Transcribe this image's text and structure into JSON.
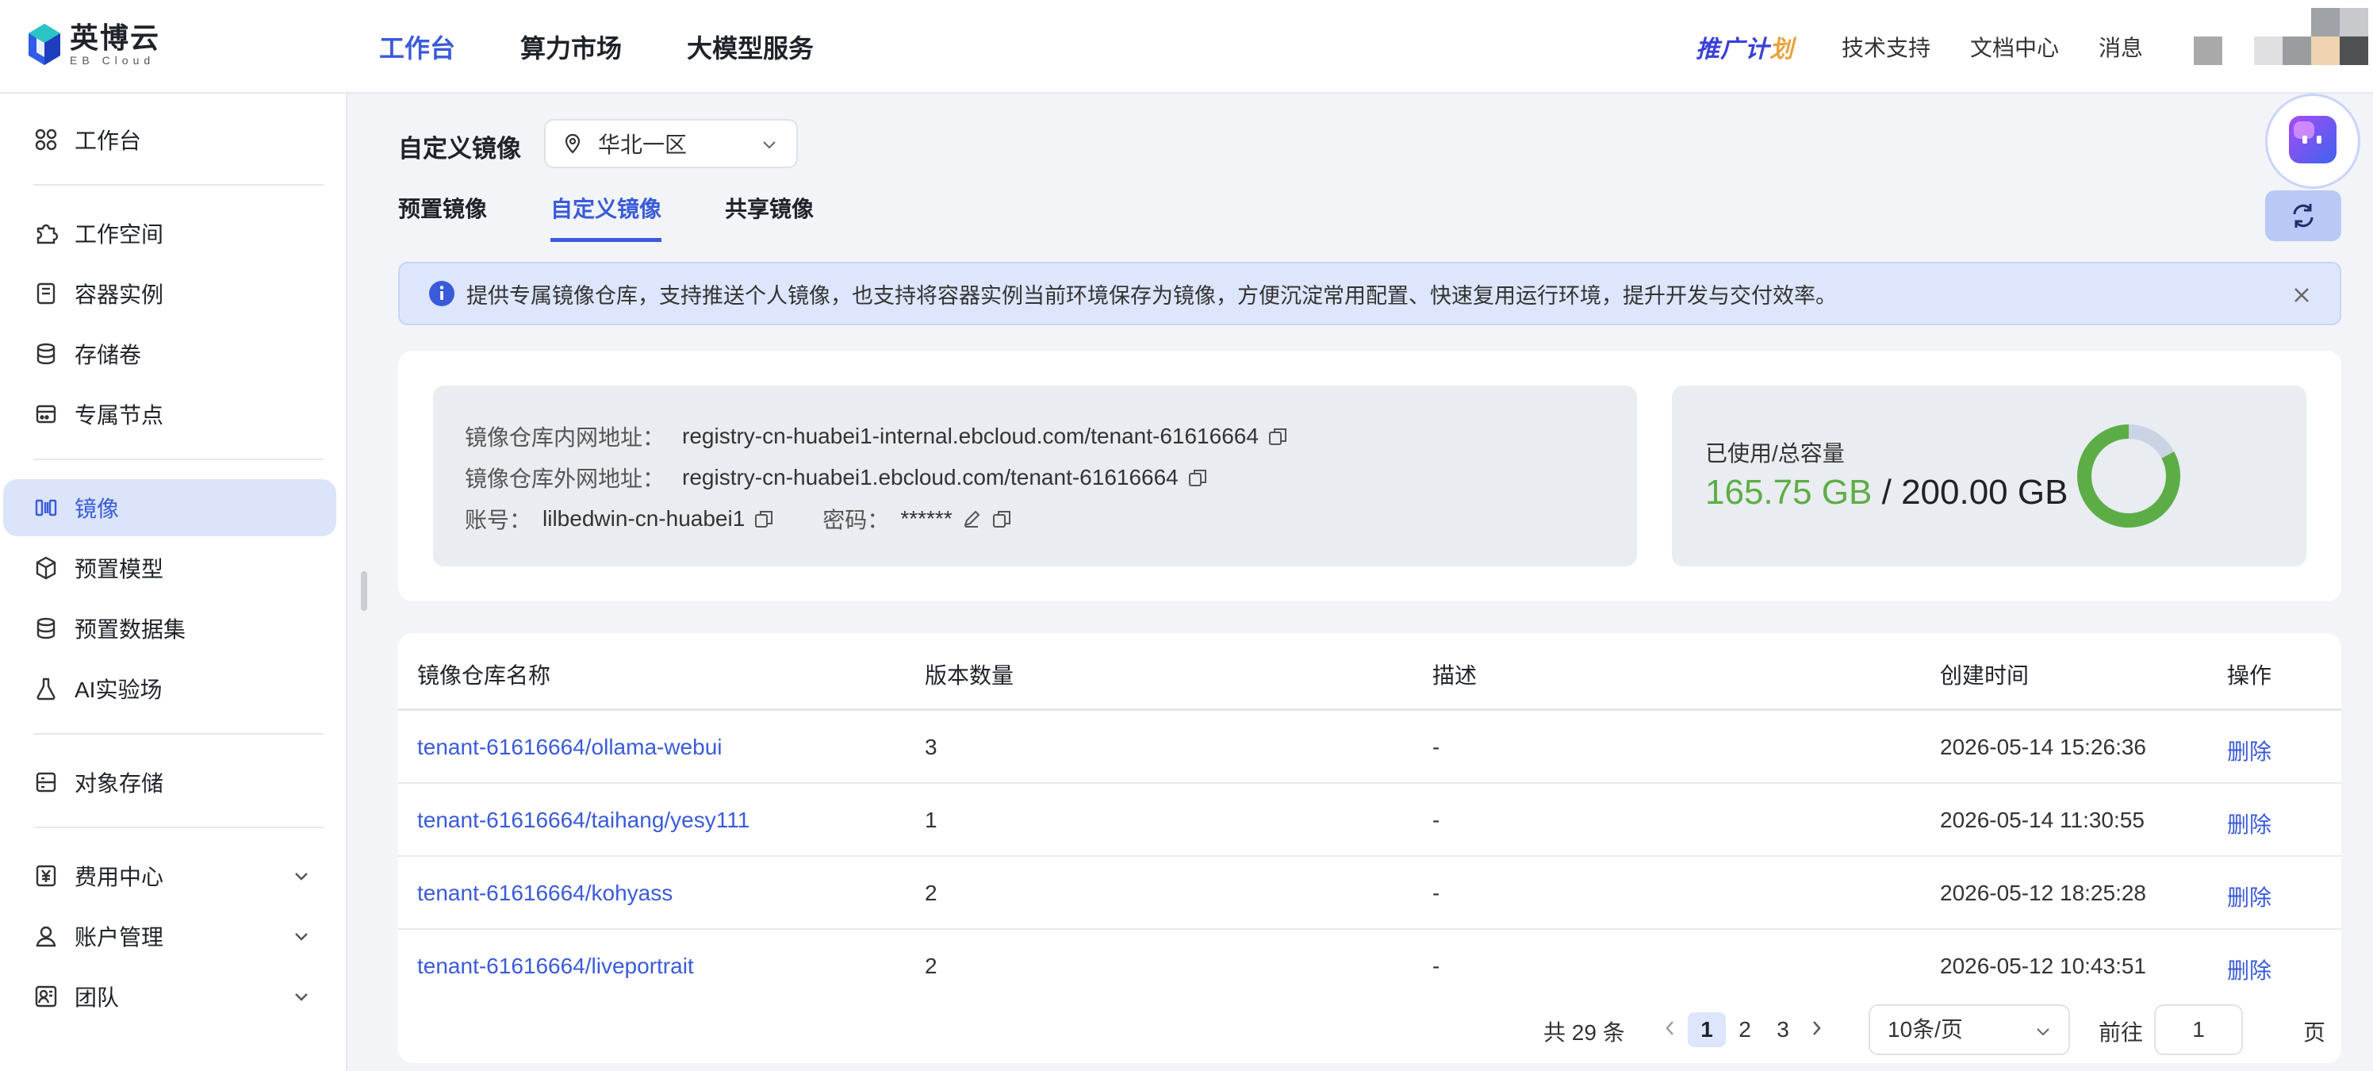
{
  "brand": {
    "name_cn": "英博云",
    "name_en": "EB Cloud"
  },
  "topnav": [
    {
      "label": "工作台",
      "active": true
    },
    {
      "label": "算力市场",
      "active": false
    },
    {
      "label": "大模型服务",
      "active": false
    }
  ],
  "topright": {
    "promo_a": "推广计",
    "promo_b": "划",
    "support": "技术支持",
    "docs": "文档中心",
    "messages": "消息"
  },
  "sidebar": {
    "workbench": "工作台",
    "workspace": "工作空间",
    "containers": "容器实例",
    "volumes": "存储卷",
    "nodes": "专属节点",
    "images": "镜像",
    "models": "预置模型",
    "datasets": "预置数据集",
    "ailab": "AI实验场",
    "oss": "对象存储",
    "billing": "费用中心",
    "account": "账户管理",
    "team": "团队"
  },
  "page": {
    "title": "自定义镜像",
    "region": "华北一区",
    "tabs": [
      "预置镜像",
      "自定义镜像",
      "共享镜像"
    ],
    "notice": "提供专属镜像仓库，支持推送个人镜像，也支持将容器实例当前环境保存为镜像，方便沉淀常用配置、快速复用运行环境，提升开发与交付效率。"
  },
  "repo": {
    "internal_label": "镜像仓库内网地址：",
    "internal_value": "registry-cn-huabei1-internal.ebcloud.com/tenant-61616664",
    "external_label": "镜像仓库外网地址：",
    "external_value": "registry-cn-huabei1.ebcloud.com/tenant-61616664",
    "account_label": "账号：",
    "account_value": "lilbedwin-cn-huabei1",
    "password_label": "密码：",
    "password_value": "******"
  },
  "usage": {
    "label": "已使用/总容量",
    "used": "165.75 GB",
    "sep": " / ",
    "total": "200.00 GB",
    "used_fraction": 0.82875,
    "used_color": "#5cad46",
    "rest_color": "#c9d3e4"
  },
  "table": {
    "headers": [
      "镜像仓库名称",
      "版本数量",
      "描述",
      "创建时间",
      "操作"
    ],
    "rows": [
      {
        "name": "tenant-61616664/ollama-webui",
        "versions": "3",
        "desc": "-",
        "created": "2026-05-14 15:26:36",
        "action": "删除"
      },
      {
        "name": "tenant-61616664/taihang/yesy111",
        "versions": "1",
        "desc": "-",
        "created": "2026-05-14 11:30:55",
        "action": "删除"
      },
      {
        "name": "tenant-61616664/kohyass",
        "versions": "2",
        "desc": "-",
        "created": "2026-05-12 18:25:28",
        "action": "删除"
      },
      {
        "name": "tenant-61616664/liveportrait",
        "versions": "2",
        "desc": "-",
        "created": "2026-05-12 10:43:51",
        "action": "删除"
      }
    ]
  },
  "pager": {
    "total": "共 29 条",
    "pages": [
      "1",
      "2",
      "3"
    ],
    "size": "10条/页",
    "goto": "前往",
    "goto_value": "1",
    "page_unit": "页"
  }
}
